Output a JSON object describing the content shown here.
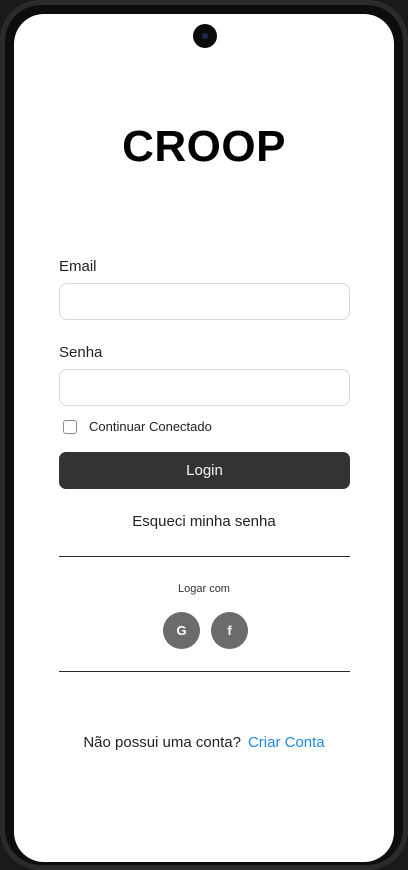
{
  "app": {
    "logo": "CROOP"
  },
  "form": {
    "email_label": "Email",
    "email_value": "",
    "password_label": "Senha",
    "password_value": "",
    "remember_label": "Continuar Conectado",
    "remember_checked": false,
    "login_label": "Login",
    "forgot_label": "Esqueci minha senha"
  },
  "social": {
    "title": "Logar com",
    "google_label": "G",
    "facebook_label": "f",
    "button_color": "#6b6b6b"
  },
  "signup": {
    "prompt": "Não possui uma conta?",
    "link_label": "Criar Conta",
    "link_color": "#1e88e5"
  },
  "theme": {
    "primary_button": "#333333"
  }
}
